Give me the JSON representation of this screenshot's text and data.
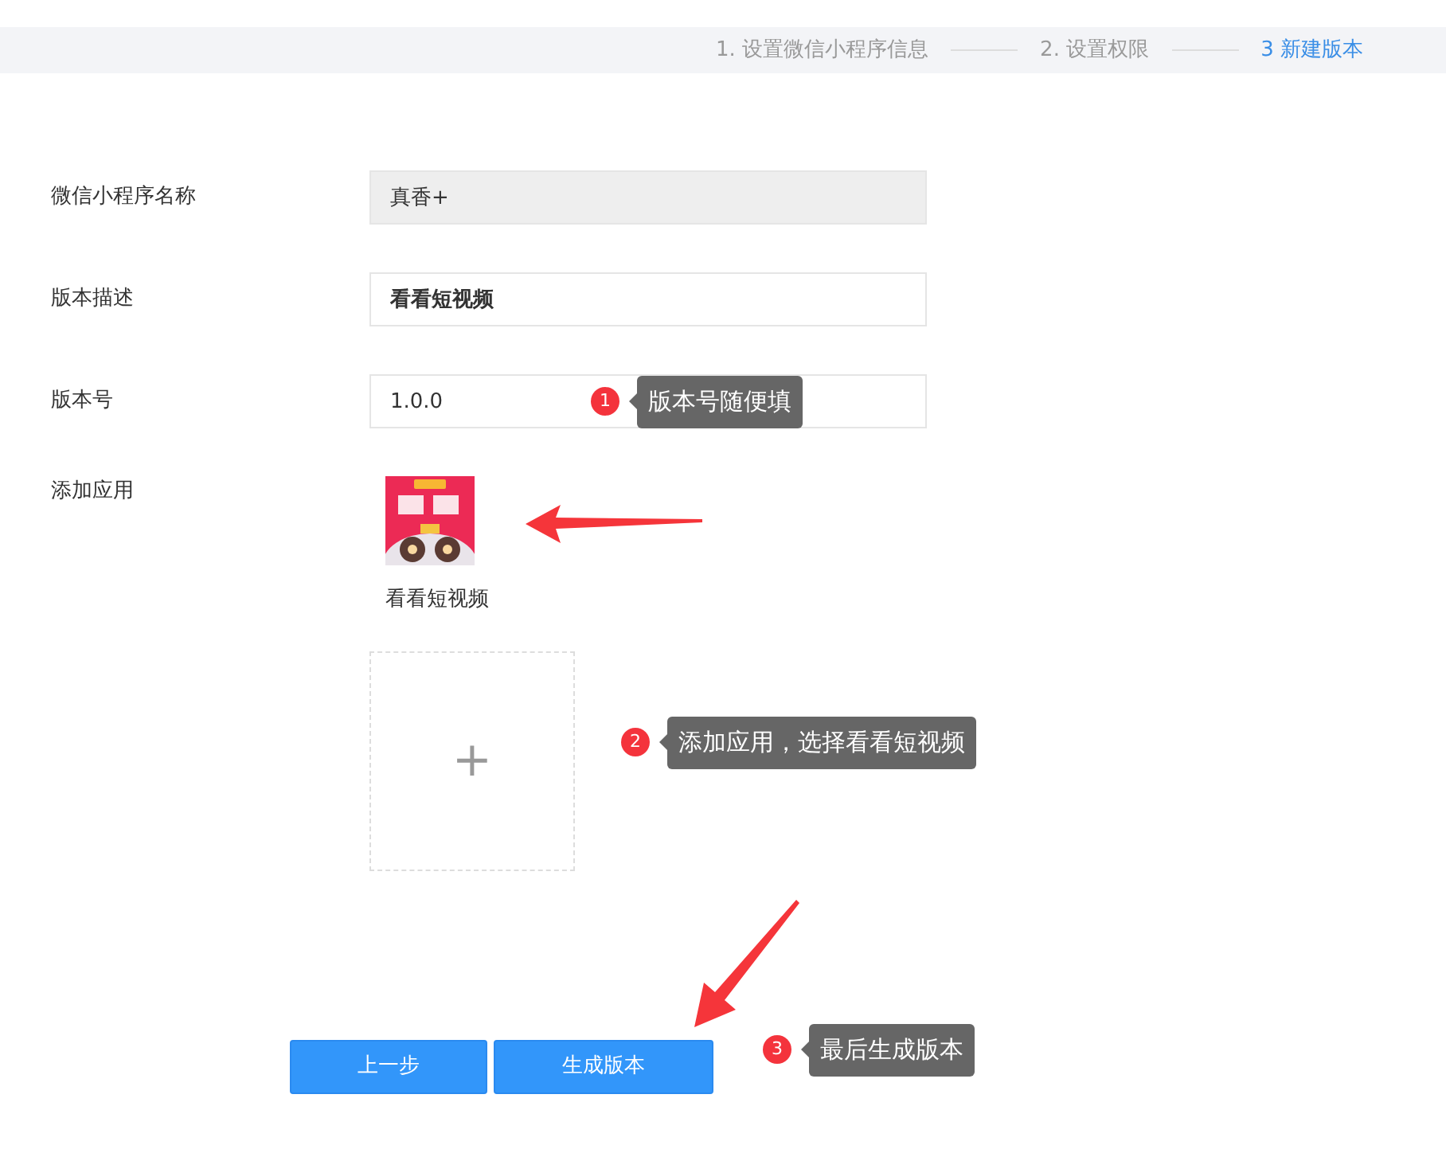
{
  "steps": [
    {
      "label": "1. 设置微信小程序信息",
      "selected": false
    },
    {
      "label": "2. 设置权限",
      "selected": false
    },
    {
      "label": "3 新建版本",
      "selected": true
    }
  ],
  "form": {
    "fields": [
      {
        "label": "微信小程序名称",
        "value": "真香+",
        "disabled": true
      },
      {
        "label": "版本描述",
        "value": "看看短视频",
        "disabled": false
      },
      {
        "label": "版本号",
        "value": "1.0.0",
        "disabled": false
      }
    ],
    "apps": {
      "label": "添加应用",
      "items": [
        {
          "kind": "picture",
          "name": "看看短视频"
        }
      ],
      "add_symbol": "+"
    }
  },
  "buttons": [
    {
      "label": "上一步"
    },
    {
      "label": "生成版本"
    }
  ],
  "annotations": [
    {
      "number": "1",
      "text": "版本号随便填"
    },
    {
      "number": "2",
      "text": "添加应用，选择看看短视频"
    },
    {
      "number": "3",
      "text": "最后生成版本"
    }
  ]
}
